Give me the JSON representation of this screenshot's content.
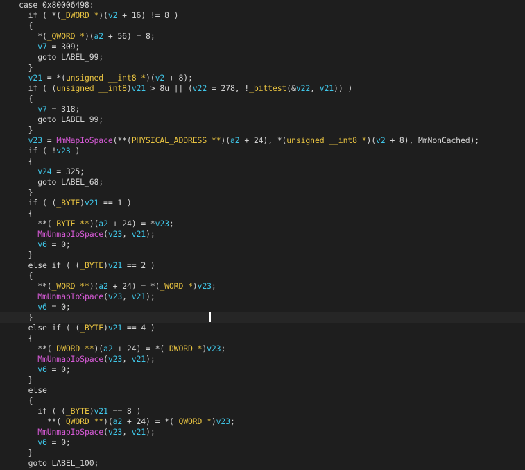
{
  "editor": {
    "language": "decompiled-c",
    "colors": {
      "background": "#1e1e1e",
      "current_line": "#262626",
      "plain": "#d4d4d4",
      "variable": "#3fc6e8",
      "type": "#e8c341",
      "function": "#d65ad6"
    },
    "current_line_index": 30,
    "code_lines": [
      [
        {
          "t": "    case 0x80006498:",
          "c": "plain"
        }
      ],
      [
        {
          "t": "      if ( *(",
          "c": "plain"
        },
        {
          "t": "_DWORD *",
          "c": "type"
        },
        {
          "t": ")(",
          "c": "plain"
        },
        {
          "t": "v2",
          "c": "var"
        },
        {
          "t": " + 16) != 8 )",
          "c": "plain"
        }
      ],
      [
        {
          "t": "      {",
          "c": "plain"
        }
      ],
      [
        {
          "t": "        *(",
          "c": "plain"
        },
        {
          "t": "_QWORD *",
          "c": "type"
        },
        {
          "t": ")(",
          "c": "plain"
        },
        {
          "t": "a2",
          "c": "var"
        },
        {
          "t": " + 56) = 8;",
          "c": "plain"
        }
      ],
      [
        {
          "t": "        ",
          "c": "plain"
        },
        {
          "t": "v7",
          "c": "var"
        },
        {
          "t": " = 309;",
          "c": "plain"
        }
      ],
      [
        {
          "t": "        goto LABEL_99;",
          "c": "plain"
        }
      ],
      [
        {
          "t": "      }",
          "c": "plain"
        }
      ],
      [
        {
          "t": "      ",
          "c": "plain"
        },
        {
          "t": "v21",
          "c": "var"
        },
        {
          "t": " = *(",
          "c": "plain"
        },
        {
          "t": "unsigned __int8 *",
          "c": "type"
        },
        {
          "t": ")(",
          "c": "plain"
        },
        {
          "t": "v2",
          "c": "var"
        },
        {
          "t": " + 8);",
          "c": "plain"
        }
      ],
      [
        {
          "t": "      if ( (",
          "c": "plain"
        },
        {
          "t": "unsigned __int8",
          "c": "type"
        },
        {
          "t": ")",
          "c": "plain"
        },
        {
          "t": "v21",
          "c": "var"
        },
        {
          "t": " > 8u || (",
          "c": "plain"
        },
        {
          "t": "v22",
          "c": "var"
        },
        {
          "t": " = 278, !",
          "c": "plain"
        },
        {
          "t": "_bittest",
          "c": "type"
        },
        {
          "t": "(&",
          "c": "plain"
        },
        {
          "t": "v22",
          "c": "var"
        },
        {
          "t": ", ",
          "c": "plain"
        },
        {
          "t": "v21",
          "c": "var"
        },
        {
          "t": ")) )",
          "c": "plain"
        }
      ],
      [
        {
          "t": "      {",
          "c": "plain"
        }
      ],
      [
        {
          "t": "        ",
          "c": "plain"
        },
        {
          "t": "v7",
          "c": "var"
        },
        {
          "t": " = 318;",
          "c": "plain"
        }
      ],
      [
        {
          "t": "        goto LABEL_99;",
          "c": "plain"
        }
      ],
      [
        {
          "t": "      }",
          "c": "plain"
        }
      ],
      [
        {
          "t": "      ",
          "c": "plain"
        },
        {
          "t": "v23",
          "c": "var"
        },
        {
          "t": " = ",
          "c": "plain"
        },
        {
          "t": "MmMapIoSpace",
          "c": "func"
        },
        {
          "t": "(**(",
          "c": "plain"
        },
        {
          "t": "PHYSICAL_ADDRESS **",
          "c": "type"
        },
        {
          "t": ")(",
          "c": "plain"
        },
        {
          "t": "a2",
          "c": "var"
        },
        {
          "t": " + 24), *(",
          "c": "plain"
        },
        {
          "t": "unsigned __int8 *",
          "c": "type"
        },
        {
          "t": ")(",
          "c": "plain"
        },
        {
          "t": "v2",
          "c": "var"
        },
        {
          "t": " + 8), MmNonCached);",
          "c": "plain"
        }
      ],
      [
        {
          "t": "      if ( !",
          "c": "plain"
        },
        {
          "t": "v23",
          "c": "var"
        },
        {
          "t": " )",
          "c": "plain"
        }
      ],
      [
        {
          "t": "      {",
          "c": "plain"
        }
      ],
      [
        {
          "t": "        ",
          "c": "plain"
        },
        {
          "t": "v24",
          "c": "var"
        },
        {
          "t": " = 325;",
          "c": "plain"
        }
      ],
      [
        {
          "t": "        goto LABEL_68;",
          "c": "plain"
        }
      ],
      [
        {
          "t": "      }",
          "c": "plain"
        }
      ],
      [
        {
          "t": "      if ( (",
          "c": "plain"
        },
        {
          "t": "_BYTE",
          "c": "type"
        },
        {
          "t": ")",
          "c": "plain"
        },
        {
          "t": "v21",
          "c": "var"
        },
        {
          "t": " == 1 )",
          "c": "plain"
        }
      ],
      [
        {
          "t": "      {",
          "c": "plain"
        }
      ],
      [
        {
          "t": "        **(",
          "c": "plain"
        },
        {
          "t": "_BYTE **",
          "c": "type"
        },
        {
          "t": ")(",
          "c": "plain"
        },
        {
          "t": "a2",
          "c": "var"
        },
        {
          "t": " + 24) = *",
          "c": "plain"
        },
        {
          "t": "v23",
          "c": "var"
        },
        {
          "t": ";",
          "c": "plain"
        }
      ],
      [
        {
          "t": "        ",
          "c": "plain"
        },
        {
          "t": "MmUnmapIoSpace",
          "c": "func"
        },
        {
          "t": "(",
          "c": "plain"
        },
        {
          "t": "v23",
          "c": "var"
        },
        {
          "t": ", ",
          "c": "plain"
        },
        {
          "t": "v21",
          "c": "var"
        },
        {
          "t": ");",
          "c": "plain"
        }
      ],
      [
        {
          "t": "        ",
          "c": "plain"
        },
        {
          "t": "v6",
          "c": "var"
        },
        {
          "t": " = 0;",
          "c": "plain"
        }
      ],
      [
        {
          "t": "      }",
          "c": "plain"
        }
      ],
      [
        {
          "t": "      else if ( (",
          "c": "plain"
        },
        {
          "t": "_BYTE",
          "c": "type"
        },
        {
          "t": ")",
          "c": "plain"
        },
        {
          "t": "v21",
          "c": "var"
        },
        {
          "t": " == 2 )",
          "c": "plain"
        }
      ],
      [
        {
          "t": "      {",
          "c": "plain"
        }
      ],
      [
        {
          "t": "        **(",
          "c": "plain"
        },
        {
          "t": "_WORD **",
          "c": "type"
        },
        {
          "t": ")(",
          "c": "plain"
        },
        {
          "t": "a2",
          "c": "var"
        },
        {
          "t": " + 24) = *(",
          "c": "plain"
        },
        {
          "t": "_WORD *",
          "c": "type"
        },
        {
          "t": ")",
          "c": "plain"
        },
        {
          "t": "v23",
          "c": "var"
        },
        {
          "t": ";",
          "c": "plain"
        }
      ],
      [
        {
          "t": "        ",
          "c": "plain"
        },
        {
          "t": "MmUnmapIoSpace",
          "c": "func"
        },
        {
          "t": "(",
          "c": "plain"
        },
        {
          "t": "v23",
          "c": "var"
        },
        {
          "t": ", ",
          "c": "plain"
        },
        {
          "t": "v21",
          "c": "var"
        },
        {
          "t": ");",
          "c": "plain"
        }
      ],
      [
        {
          "t": "        ",
          "c": "plain"
        },
        {
          "t": "v6",
          "c": "var"
        },
        {
          "t": " = 0;",
          "c": "plain"
        }
      ],
      [
        {
          "t": "      }",
          "c": "plain"
        }
      ],
      [
        {
          "t": "      else if ( (",
          "c": "plain"
        },
        {
          "t": "_BYTE",
          "c": "type"
        },
        {
          "t": ")",
          "c": "plain"
        },
        {
          "t": "v21",
          "c": "var"
        },
        {
          "t": " == 4 )",
          "c": "plain"
        }
      ],
      [
        {
          "t": "      {",
          "c": "plain"
        }
      ],
      [
        {
          "t": "        **(",
          "c": "plain"
        },
        {
          "t": "_DWORD **",
          "c": "type"
        },
        {
          "t": ")(",
          "c": "plain"
        },
        {
          "t": "a2",
          "c": "var"
        },
        {
          "t": " + 24) = *(",
          "c": "plain"
        },
        {
          "t": "_DWORD *",
          "c": "type"
        },
        {
          "t": ")",
          "c": "plain"
        },
        {
          "t": "v23",
          "c": "var"
        },
        {
          "t": ";",
          "c": "plain"
        }
      ],
      [
        {
          "t": "        ",
          "c": "plain"
        },
        {
          "t": "MmUnmapIoSpace",
          "c": "func"
        },
        {
          "t": "(",
          "c": "plain"
        },
        {
          "t": "v23",
          "c": "var"
        },
        {
          "t": ", ",
          "c": "plain"
        },
        {
          "t": "v21",
          "c": "var"
        },
        {
          "t": ");",
          "c": "plain"
        }
      ],
      [
        {
          "t": "        ",
          "c": "plain"
        },
        {
          "t": "v6",
          "c": "var"
        },
        {
          "t": " = 0;",
          "c": "plain"
        }
      ],
      [
        {
          "t": "      }",
          "c": "plain"
        }
      ],
      [
        {
          "t": "      else",
          "c": "plain"
        }
      ],
      [
        {
          "t": "      {",
          "c": "plain"
        }
      ],
      [
        {
          "t": "        if ( (",
          "c": "plain"
        },
        {
          "t": "_BYTE",
          "c": "type"
        },
        {
          "t": ")",
          "c": "plain"
        },
        {
          "t": "v21",
          "c": "var"
        },
        {
          "t": " == 8 )",
          "c": "plain"
        }
      ],
      [
        {
          "t": "          **(",
          "c": "plain"
        },
        {
          "t": "_QWORD **",
          "c": "type"
        },
        {
          "t": ")(",
          "c": "plain"
        },
        {
          "t": "a2",
          "c": "var"
        },
        {
          "t": " + 24) = *(",
          "c": "plain"
        },
        {
          "t": "_QWORD *",
          "c": "type"
        },
        {
          "t": ")",
          "c": "plain"
        },
        {
          "t": "v23",
          "c": "var"
        },
        {
          "t": ";",
          "c": "plain"
        }
      ],
      [
        {
          "t": "        ",
          "c": "plain"
        },
        {
          "t": "MmUnmapIoSpace",
          "c": "func"
        },
        {
          "t": "(",
          "c": "plain"
        },
        {
          "t": "v23",
          "c": "var"
        },
        {
          "t": ", ",
          "c": "plain"
        },
        {
          "t": "v21",
          "c": "var"
        },
        {
          "t": ");",
          "c": "plain"
        }
      ],
      [
        {
          "t": "        ",
          "c": "plain"
        },
        {
          "t": "v6",
          "c": "var"
        },
        {
          "t": " = 0;",
          "c": "plain"
        }
      ],
      [
        {
          "t": "      }",
          "c": "plain"
        }
      ],
      [
        {
          "t": "      goto LABEL_100;",
          "c": "plain"
        }
      ]
    ]
  }
}
